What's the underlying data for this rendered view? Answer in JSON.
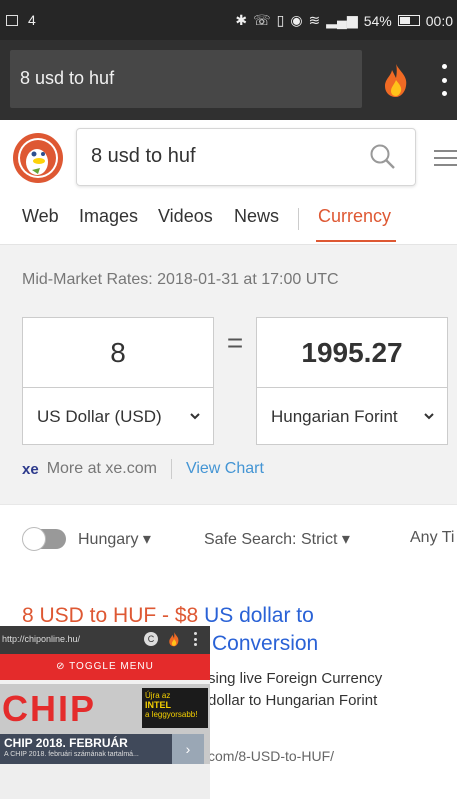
{
  "status_bar": {
    "notification_count": "4",
    "battery_percent": "54%",
    "time": "00:0"
  },
  "browser": {
    "address_text": "8 usd to huf"
  },
  "search": {
    "query": "8 usd to huf"
  },
  "tabs": [
    {
      "label": "Web"
    },
    {
      "label": "Images"
    },
    {
      "label": "Videos"
    },
    {
      "label": "News"
    },
    {
      "label": "Currency",
      "active": true
    }
  ],
  "currency": {
    "rates_label": "Mid-Market Rates: 2018-01-31 at 17:00 UTC",
    "from_amount": "8",
    "to_amount": "1995.27",
    "equals": "=",
    "from_currency": "US Dollar (USD)",
    "to_currency": "Hungarian Forint",
    "xe_logo": "xe",
    "more_at": "More at xe.com",
    "view_chart": "View Chart"
  },
  "filters": {
    "region": "Hungary",
    "safe_search": "Safe Search: Strict",
    "time_filter": "Any Ti"
  },
  "result": {
    "title_highlight": "8 USD to HUF",
    "title_dash": " - ",
    "title_price": "$8",
    "title_rest": " US dollar to",
    "title_line2": "Conversion",
    "snippet_line1": "sing live Foreign Currency",
    "snippet_line2": "dollar to Hungarian Forint",
    "url": "com/8-USD-to-HUF/"
  },
  "overlay": {
    "url": "http://chiponline.hu/",
    "c_label": "C",
    "menu_label": "⊘ TOGGLE MENU",
    "logo": "CHIP",
    "ad_line1": "Újra az",
    "ad_line2": "INTEL",
    "ad_line3": "a leggyorsabb!",
    "edition_title": "CHIP 2018. FEBRUÁR",
    "edition_sub": "A CHIP 2018. februári számának tartalmá...",
    "next": "›"
  },
  "colors": {
    "accent": "#de5833",
    "link": "#2a62d6",
    "view_chart": "#4495d4"
  }
}
